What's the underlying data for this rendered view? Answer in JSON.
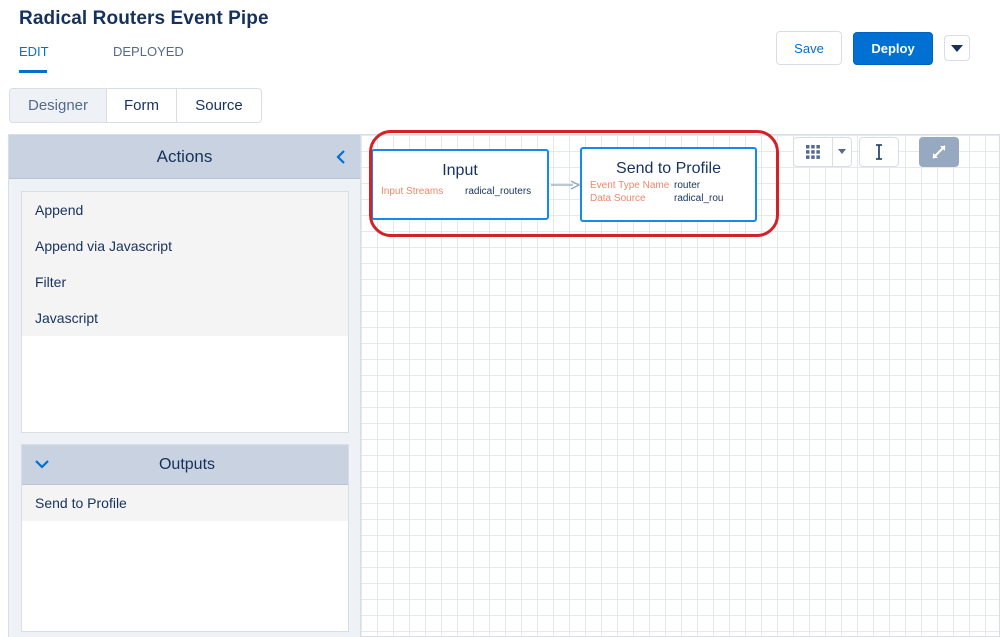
{
  "header": {
    "title": "Radical Routers Event Pipe",
    "tabs": [
      {
        "label": "EDIT",
        "active": true
      },
      {
        "label": "DEPLOYED",
        "active": false
      }
    ],
    "save_label": "Save",
    "deploy_label": "Deploy"
  },
  "view_switcher": {
    "options": [
      "Designer",
      "Form",
      "Source"
    ],
    "selected": "Designer"
  },
  "sidebar": {
    "actions_title": "Actions",
    "actions": [
      "Append",
      "Append via Javascript",
      "Filter",
      "Javascript"
    ],
    "outputs_title": "Outputs",
    "outputs": [
      "Send to Profile"
    ]
  },
  "canvas": {
    "nodes": {
      "input": {
        "title": "Input",
        "fields": [
          {
            "key": "Input Streams",
            "value": "radical_routers"
          }
        ]
      },
      "send_to_profile": {
        "title": "Send to Profile",
        "fields": [
          {
            "key": "Event Type Name",
            "value": "router"
          },
          {
            "key": "Data Source",
            "value": "radical_rou"
          }
        ]
      }
    }
  },
  "colors": {
    "brand_blue": "#0070d2",
    "node_border": "#1589ee",
    "field_key": "#f0876c",
    "highlight": "#d42027",
    "header_band": "#c8d2e0"
  }
}
